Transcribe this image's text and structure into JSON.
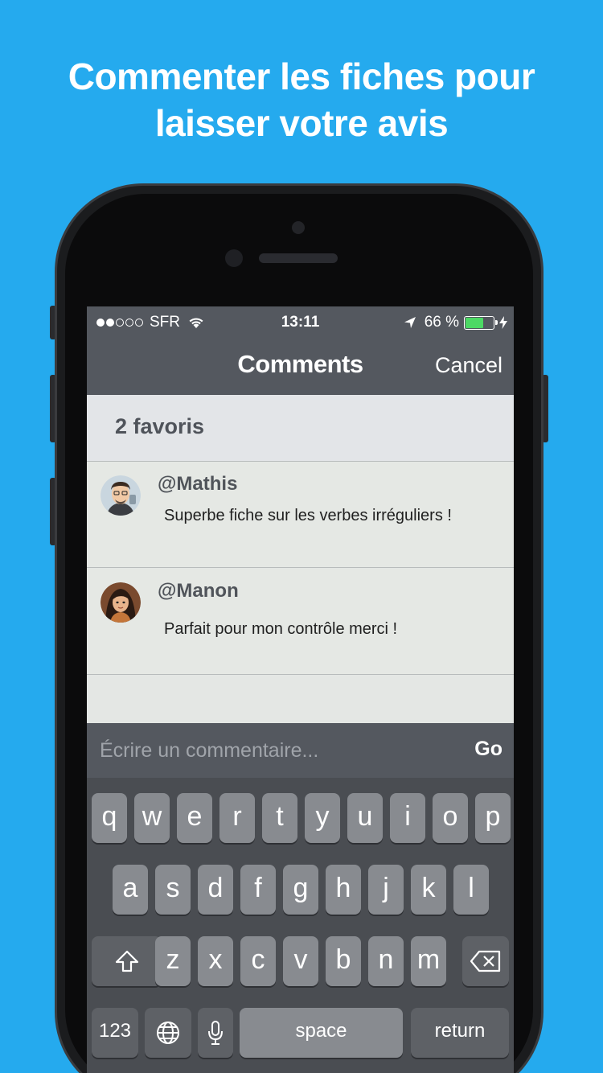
{
  "promo": {
    "line1": "Commenter les fiches pour",
    "line2": "laisser votre avis"
  },
  "status": {
    "carrier": "SFR",
    "time": "13:11",
    "battery_text": "66 %",
    "battery_level": 0.66,
    "signal_bars_filled": 2,
    "signal_bars_total": 5
  },
  "nav": {
    "title": "Comments",
    "cancel": "Cancel"
  },
  "section": {
    "header": "2 favoris"
  },
  "comments": [
    {
      "user": "@Mathis",
      "text": "Superbe fiche sur les verbes irréguliers !"
    },
    {
      "user": "@Manon",
      "text": "Parfait pour mon contrôle merci !"
    }
  ],
  "composer": {
    "placeholder": "Écrire un commentaire...",
    "go": "Go"
  },
  "keyboard": {
    "row1": [
      "q",
      "w",
      "e",
      "r",
      "t",
      "y",
      "u",
      "i",
      "o",
      "p"
    ],
    "row2": [
      "a",
      "s",
      "d",
      "f",
      "g",
      "h",
      "j",
      "k",
      "l"
    ],
    "row3": [
      "z",
      "x",
      "c",
      "v",
      "b",
      "n",
      "m"
    ],
    "numbers": "123",
    "space": "space",
    "return": "return"
  },
  "colors": {
    "background": "#25aaee",
    "bar": "#54585f",
    "battery": "#4cd964"
  }
}
